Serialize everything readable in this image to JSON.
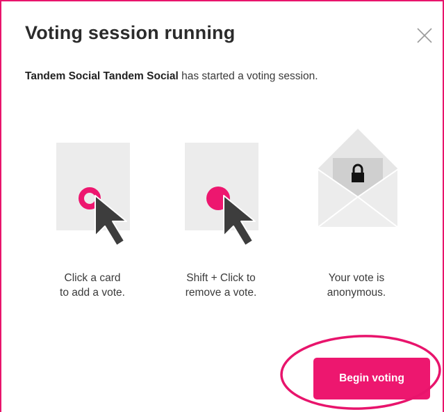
{
  "dialog": {
    "title": "Voting session running",
    "subtitle_name": "Tandem Social Tandem Social",
    "subtitle_rest": " has started a voting session.",
    "close_icon": "close-icon"
  },
  "steps": [
    {
      "icon": "card-click-icon",
      "line1": "Click a card",
      "line2": "to add a vote."
    },
    {
      "icon": "card-shift-click-icon",
      "line1": "Shift + Click to",
      "line2": "remove a vote."
    },
    {
      "icon": "locked-envelope-icon",
      "line1": "Your vote is",
      "line2": "anonymous."
    }
  ],
  "actions": {
    "begin_label": "Begin voting"
  },
  "colors": {
    "accent": "#ed176f",
    "border": "#e8146c",
    "card": "#ececec",
    "cursor": "#3d3d3d",
    "envelope": "#e6e6e6"
  }
}
